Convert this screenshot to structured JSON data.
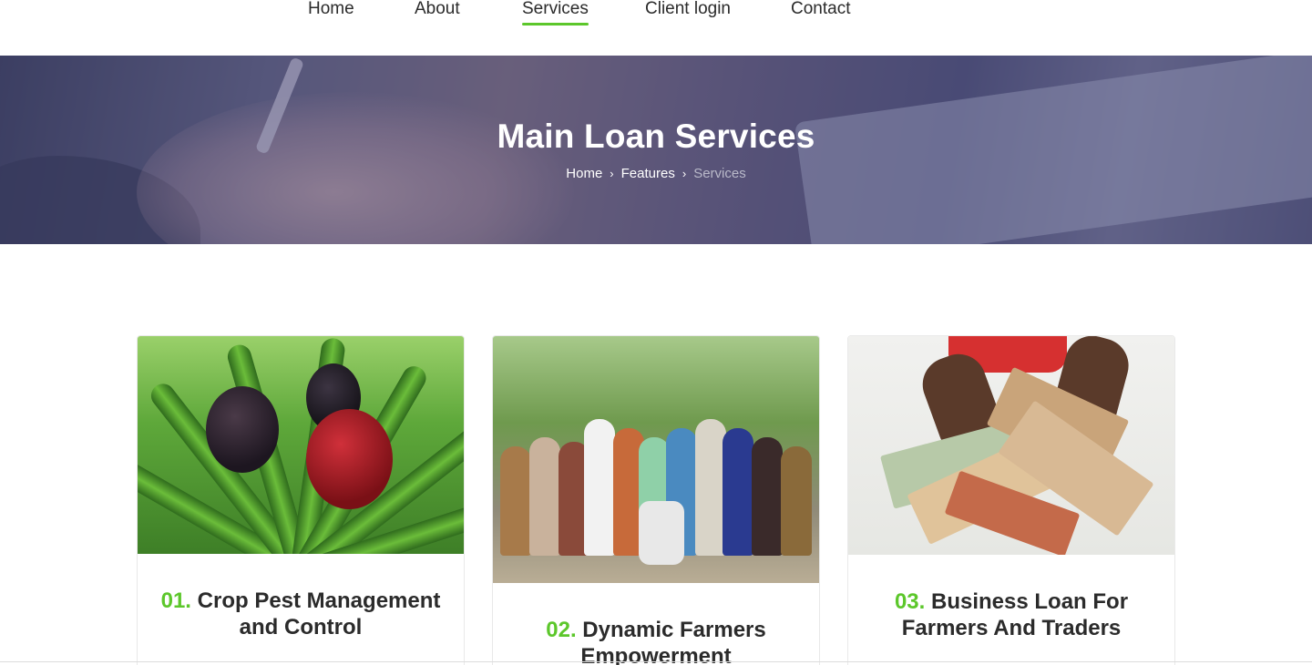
{
  "nav": {
    "items": [
      {
        "label": "Home"
      },
      {
        "label": "About"
      },
      {
        "label": "Services",
        "active": true
      },
      {
        "label": "Client login"
      },
      {
        "label": "Contact"
      }
    ]
  },
  "hero": {
    "title": "Main Loan Services",
    "breadcrumb": [
      "Home",
      "Features",
      "Services"
    ]
  },
  "services": [
    {
      "number": "01.",
      "title": "Crop Pest Management and Control"
    },
    {
      "number": "02.",
      "title": "Dynamic Farmers Empowerment"
    },
    {
      "number": "03.",
      "title": "Business Loan For Farmers And Traders"
    }
  ],
  "colors": {
    "accent": "#5cc72b",
    "text": "#2b2b2b"
  }
}
